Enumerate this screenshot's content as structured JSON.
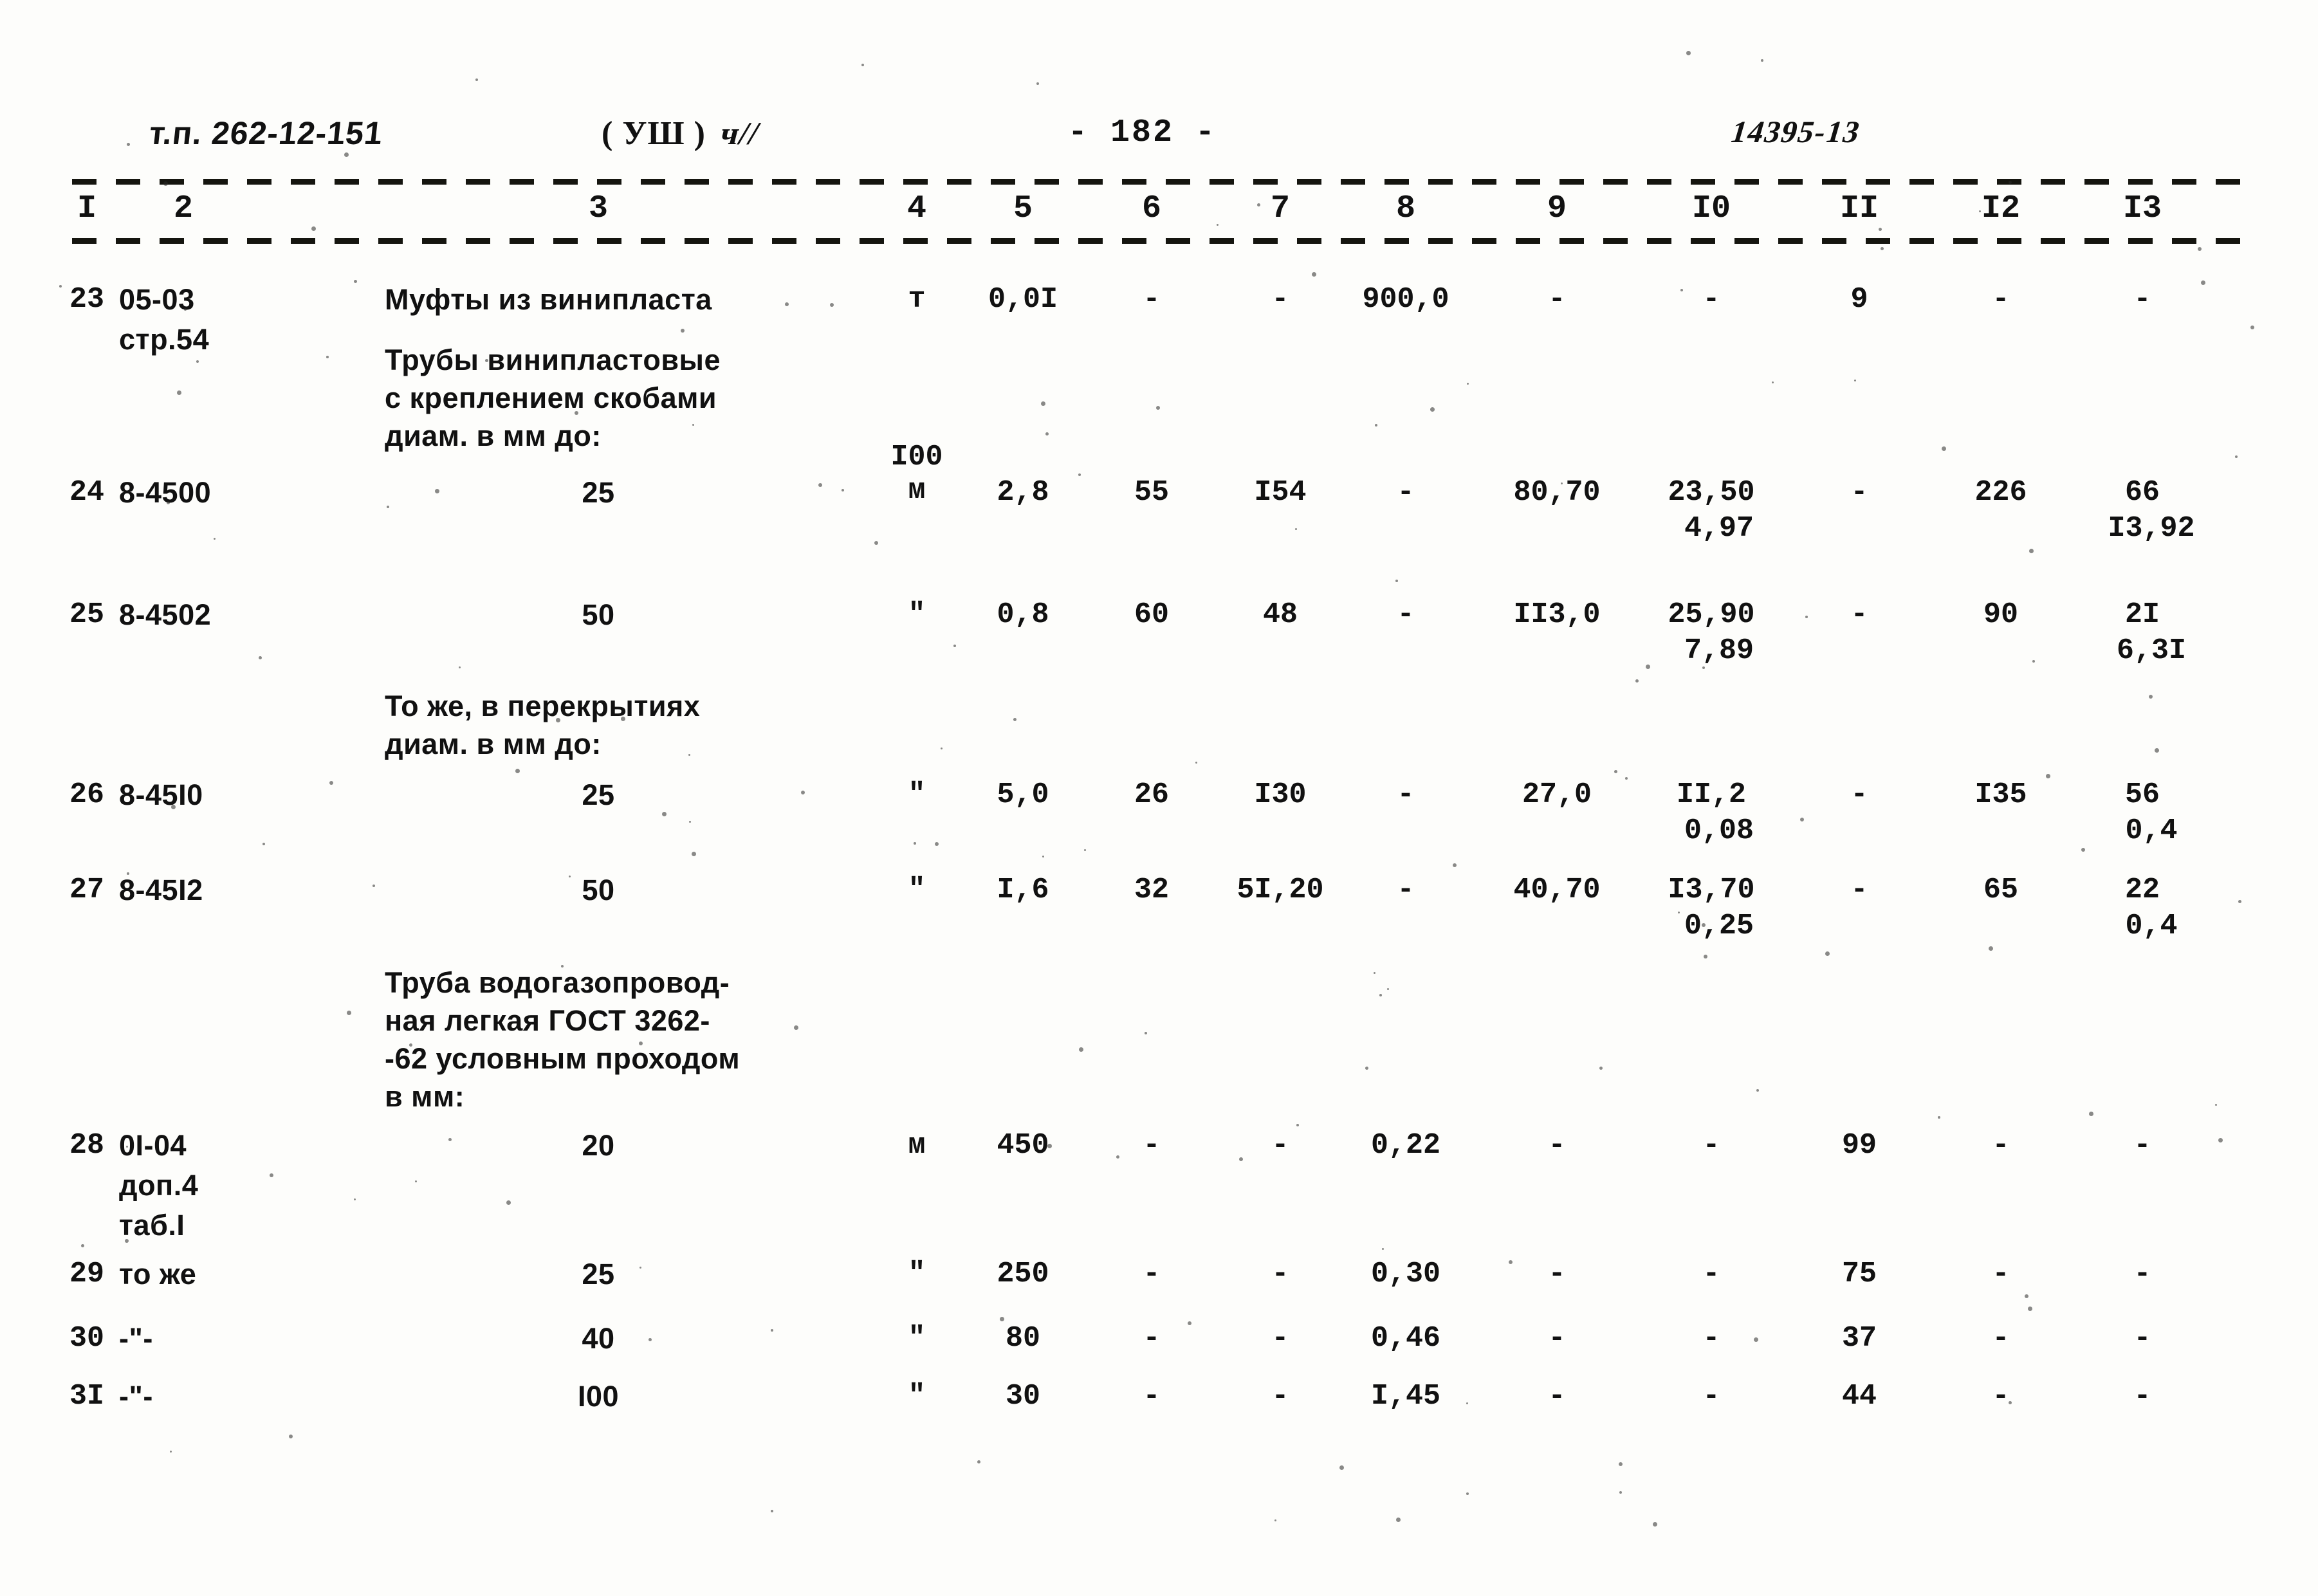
{
  "header": {
    "doc_code": "т.п. 262-12-151",
    "section_paren": "( УШ )",
    "hand_note": "ч//",
    "page_label": "- 182 -",
    "archive_stamp": "14395-13"
  },
  "table": {
    "column_headers": [
      "I",
      "2",
      "3",
      "4",
      "5",
      "6",
      "7",
      "8",
      "9",
      "I0",
      "II",
      "I2",
      "I3"
    ],
    "rows": [
      {
        "kind": "data",
        "c1": "23",
        "c2": [
          "05-03",
          "стр.54"
        ],
        "c3": "Муфты из винипласта",
        "c3_align": "left",
        "c4": "т",
        "c5": "0,0I",
        "c6": "-",
        "c7": "-",
        "c8": "900,0",
        "c9": "-",
        "c10": "-",
        "c10b": "",
        "c11": "9",
        "c12": "-",
        "c13": "-",
        "c13b": ""
      },
      {
        "kind": "caption",
        "text": "Трубы винипластовые\nс креплением скобами\nдиам. в мм до:"
      },
      {
        "kind": "data",
        "c1": "24",
        "c2": [
          "8-4500"
        ],
        "c3": "25",
        "c3_align": "center",
        "c4": "I00\nм",
        "c5": "2,8",
        "c6": "55",
        "c7": "I54",
        "c8": "-",
        "c9": "80,70",
        "c10": "23,50",
        "c10b": "4,97",
        "c11": "-",
        "c12": "226",
        "c13": "66",
        "c13b": "I3,92"
      },
      {
        "kind": "data",
        "c1": "25",
        "c2": [
          "8-4502"
        ],
        "c3": "50",
        "c3_align": "center",
        "c4": "\"",
        "c5": "0,8",
        "c6": "60",
        "c7": "48",
        "c8": "-",
        "c9": "II3,0",
        "c10": "25,90",
        "c10b": "7,89",
        "c11": "-",
        "c12": "90",
        "c13": "2I",
        "c13b": "6,3I"
      },
      {
        "kind": "caption",
        "text": "То же, в перекрытиях\nдиам. в мм до:"
      },
      {
        "kind": "data",
        "c1": "26",
        "c2": [
          "8-45I0"
        ],
        "c3": "25",
        "c3_align": "center",
        "c4": "\"",
        "c5": "5,0",
        "c6": "26",
        "c7": "I30",
        "c8": "-",
        "c9": "27,0",
        "c10": "II,2",
        "c10b": "0,08",
        "c11": "-",
        "c12": "I35",
        "c13": "56",
        "c13b": "0,4"
      },
      {
        "kind": "data",
        "c1": "27",
        "c2": [
          "8-45I2"
        ],
        "c3": "50",
        "c3_align": "center",
        "c4": "\"",
        "c5": "I,6",
        "c6": "32",
        "c7": "5I,20",
        "c8": "-",
        "c9": "40,70",
        "c10": "I3,70",
        "c10b": "0,25",
        "c11": "-",
        "c12": "65",
        "c13": "22",
        "c13b": "0,4"
      },
      {
        "kind": "caption",
        "text": "Труба водогазопровод-\nная легкая ГОСТ 3262-\n-62 условным проходом\nв мм:"
      },
      {
        "kind": "data",
        "c1": "28",
        "c2": [
          "0I-04",
          "доп.4",
          "таб.I"
        ],
        "c3": "20",
        "c3_align": "center",
        "c4": "м",
        "c5": "450",
        "c6": "-",
        "c7": "-",
        "c8": "0,22",
        "c9": "-",
        "c10": "-",
        "c10b": "",
        "c11": "99",
        "c12": "-",
        "c13": "-",
        "c13b": ""
      },
      {
        "kind": "data",
        "c1": "29",
        "c2": [
          "то же"
        ],
        "c3": "25",
        "c3_align": "center",
        "c4": "\"",
        "c5": "250",
        "c6": "-",
        "c7": "-",
        "c8": "0,30",
        "c9": "-",
        "c10": "-",
        "c10b": "",
        "c11": "75",
        "c12": "-",
        "c13": "-",
        "c13b": ""
      },
      {
        "kind": "data",
        "c1": "30",
        "c2": [
          "-\"-"
        ],
        "c3": "40",
        "c3_align": "center",
        "c4": "\"",
        "c5": "80",
        "c6": "-",
        "c7": "-",
        "c8": "0,46",
        "c9": "-",
        "c10": "-",
        "c10b": "",
        "c11": "37",
        "c12": "-",
        "c13": "-",
        "c13b": ""
      },
      {
        "kind": "data",
        "c1": "3I",
        "c2": [
          "-\"-"
        ],
        "c3": "I00",
        "c3_align": "center",
        "c4": "\"",
        "c5": "30",
        "c6": "-",
        "c7": "-",
        "c8": "I,45",
        "c9": "-",
        "c10": "-",
        "c10b": "",
        "c11": "44",
        "c12": "-",
        "c13": "-",
        "c13b": ""
      }
    ]
  },
  "colors": {
    "ink": "#111111",
    "paper": "#fdfdfb"
  }
}
